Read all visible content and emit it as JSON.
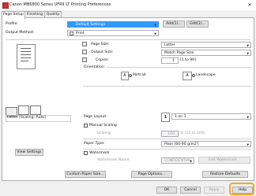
{
  "window": {
    "title": "Canon MB6800 Series UFRII LT Printing Preferences",
    "close_glyph": "✕"
  },
  "tabs": [
    {
      "label": "Page Setup"
    },
    {
      "label": "Finishing"
    },
    {
      "label": "Quality"
    }
  ],
  "profile": {
    "label": "Profile:",
    "value": "Default Settings",
    "add_label": "Add(1)...",
    "edit_label": "Edit(2)..."
  },
  "output_method": {
    "label": "Output Method:",
    "value": "Print"
  },
  "page_size": {
    "label": "Page Size:",
    "value": "Letter"
  },
  "output_size": {
    "label": "Output Size:",
    "value": "Match Page Size"
  },
  "copies": {
    "label": "Copies:",
    "value": "1",
    "range": "[1 to 99]"
  },
  "orientation": {
    "label": "Orientation",
    "portrait": "Portrait",
    "landscape": "Landscape",
    "glyph": "A"
  },
  "preview": {
    "caption": "Letter [Scaling: Auto]"
  },
  "page_layout": {
    "label": "Page Layout:",
    "value": "1 on 1",
    "glyph": "1"
  },
  "manual_scaling": {
    "label": "Manual Scaling",
    "scaling_label": "Scaling:",
    "value": "100",
    "range": "% [25 to 200]"
  },
  "paper_type": {
    "label": "Paper Type:",
    "value": "Plain [60-90 g/m2]"
  },
  "watermark": {
    "label": "Watermark",
    "name_label": "Watermark Name:",
    "value": "CONFIDENTIAL",
    "edit_label": "Edit Watermark..."
  },
  "view_settings_label": "View Settings",
  "bottom_buttons": {
    "custom": "Custom Paper Size...",
    "page_options": "Page Options...",
    "restore": "Restore Defaults"
  },
  "footer": {
    "ok": "OK",
    "cancel": "Cancel",
    "apply": "Apply",
    "help": "Help"
  },
  "colors": {
    "accent": "#3399ff",
    "highlight": "#f5a623"
  }
}
